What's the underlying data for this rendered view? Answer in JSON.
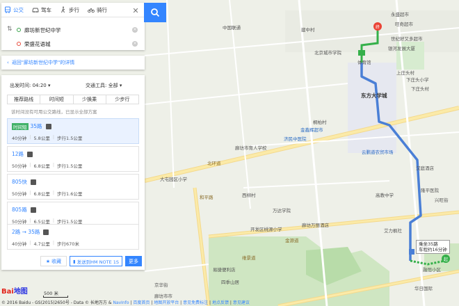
{
  "colors": {
    "accent": "#3385ff",
    "route_bus": "#4a7fd6",
    "route_walk": "#35b04a",
    "selected_bg": "#eaf2ff",
    "tag_green": "#41b168"
  },
  "mode_tabs": [
    {
      "label": "公交",
      "icon": "bus-icon",
      "active": true
    },
    {
      "label": "驾车",
      "icon": "car-icon",
      "active": false
    },
    {
      "label": "步行",
      "icon": "walk-icon",
      "active": false
    },
    {
      "label": "骑行",
      "icon": "bike-icon",
      "active": false
    }
  ],
  "route": {
    "origin": "廊坊新世纪中学",
    "destination": "荣盛花语城"
  },
  "return_link": "返回\"廊坊新世纪中学\"的详情",
  "filters": {
    "depart_label": "出发时间: 04:20",
    "vehicle_label": "交通工具: 全部"
  },
  "pref_tabs": [
    "推荐路线",
    "时间短",
    "少换乘",
    "少步行"
  ],
  "note": "该时间没有可用公交路线，已显示全部方案",
  "routes": [
    {
      "tag": "时间短",
      "name": "35路",
      "time": "40分钟",
      "distance": "5.8公里",
      "walk": "步行1.5公里"
    },
    {
      "tag": "",
      "name": "12路",
      "time": "50分钟",
      "distance": "6.8公里",
      "walk": "步行1.5公里"
    },
    {
      "tag": "",
      "name": "805快",
      "time": "50分钟",
      "distance": "6.8公里",
      "walk": "步行1.6公里"
    },
    {
      "tag": "",
      "name": "805路",
      "time": "50分钟",
      "distance": "6.5公里",
      "walk": "步行1.5公里"
    },
    {
      "tag": "",
      "name": "2路 → 35路",
      "time": "40分钟",
      "distance": "4.7公里",
      "walk": "步行670米"
    }
  ],
  "actions": {
    "fav": "收藏",
    "send": "发送到HM NOTE 1S",
    "more": "更多"
  },
  "bus_popup": {
    "line1": "乘坐35路",
    "line2": "车程约16分钟"
  },
  "scale": "500 米",
  "logo": {
    "bai": "Bai",
    "du": "地图"
  },
  "copyright_prefix": "© 2016 Baidu - GS(2015)2650号 - Data © 长地万方 &",
  "copyright_links": [
    "NavInfo",
    "百度首页",
    "地图开放平台",
    "意见免费标注",
    "地点反馈",
    "意见建议"
  ],
  "map_labels": [
    "中国联通",
    "建中村",
    "永盛超市",
    "旺奇超市",
    "世纪好又多超市",
    "银河发展大厦",
    "北京城市学院",
    "体育馆",
    "东方大学城",
    "上庄头村",
    "下庄头小学",
    "下庄头村",
    "桐柏村",
    "金鑫辉超市",
    "济民中医院",
    "廊坊市育人学校",
    "北环道",
    "云鹏道农贸市场",
    "汉庭酒店",
    "隆平医院",
    "兴旺街",
    "大屯园区小学",
    "西柳村",
    "高教中学",
    "万达学院",
    "开发区桃源小学",
    "廊坊万丽酒店",
    "艾力枫社",
    "金源道",
    "维景道",
    "融恒小区",
    "华日国际",
    "易捷便利店",
    "四季山居",
    "廊坊市市",
    "京华街",
    "和平路"
  ]
}
